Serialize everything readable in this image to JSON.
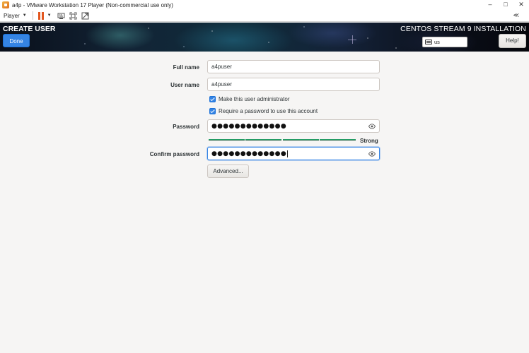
{
  "window": {
    "title": "a4p - VMware Workstation 17 Player (Non-commercial use only)",
    "controls": {
      "minimize": "–",
      "maximize": "□",
      "close": "✕"
    }
  },
  "toolbar": {
    "player_menu": "Player",
    "icons": [
      "pause-icon",
      "send-ctrl-alt-del-icon",
      "fullscreen-icon",
      "unity-icon"
    ],
    "right_icon": "≪"
  },
  "header": {
    "spoke_title": "CREATE USER",
    "done_label": "Done",
    "product_title": "CENTOS STREAM 9 INSTALLATION",
    "keyboard_layout": "us",
    "help_label": "Help!"
  },
  "form": {
    "full_name": {
      "label": "Full name",
      "value": "a4puser"
    },
    "user_name": {
      "label": "User name",
      "value": "a4puser"
    },
    "admin_checkbox": {
      "label": "Make this user administrator",
      "checked": true
    },
    "password_required_checkbox": {
      "label": "Require a password to use this account",
      "checked": true
    },
    "password": {
      "label": "Password",
      "value": "●●●●●●●●●●●●●"
    },
    "strength": {
      "label": "Strong",
      "level": 1.0
    },
    "confirm_password": {
      "label": "Confirm password",
      "value": "●●●●●●●●●●●●●"
    },
    "advanced_label": "Advanced..."
  },
  "colors": {
    "accent": "#3584e4",
    "strength": "#26a269",
    "pause": "#e2561e"
  }
}
